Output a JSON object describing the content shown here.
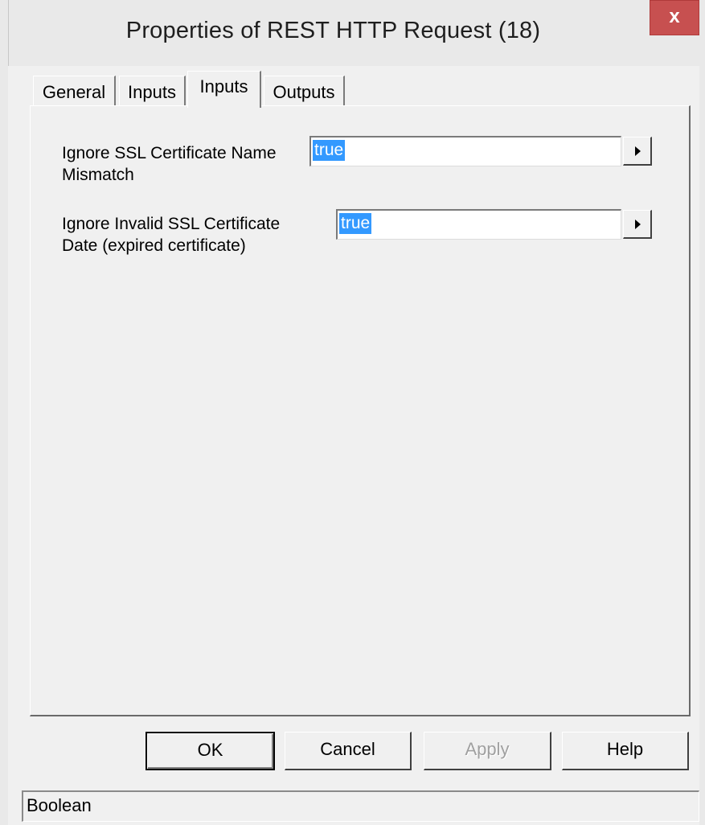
{
  "window": {
    "title": "Properties of REST HTTP Request (18)",
    "close_label": "x"
  },
  "tabs": [
    {
      "label": "General",
      "active": false
    },
    {
      "label": "Inputs",
      "active": false
    },
    {
      "label": "Inputs",
      "active": true
    },
    {
      "label": "Outputs",
      "active": false
    }
  ],
  "fields": [
    {
      "label_line1": "Ignore SSL Certificate Name",
      "label_line2": "Mismatch",
      "value": "true"
    },
    {
      "label_line1": "Ignore Invalid SSL Certificate",
      "label_line2": "Date (expired certificate)",
      "value": "true"
    }
  ],
  "buttons": {
    "ok": "OK",
    "cancel": "Cancel",
    "apply": "Apply",
    "help": "Help"
  },
  "status": {
    "text": "Boolean"
  },
  "colors": {
    "selection": "#3399ff",
    "close_button": "#c75050"
  },
  "icons": {
    "close": "close-icon",
    "dropdown": "triangle-right-icon"
  }
}
